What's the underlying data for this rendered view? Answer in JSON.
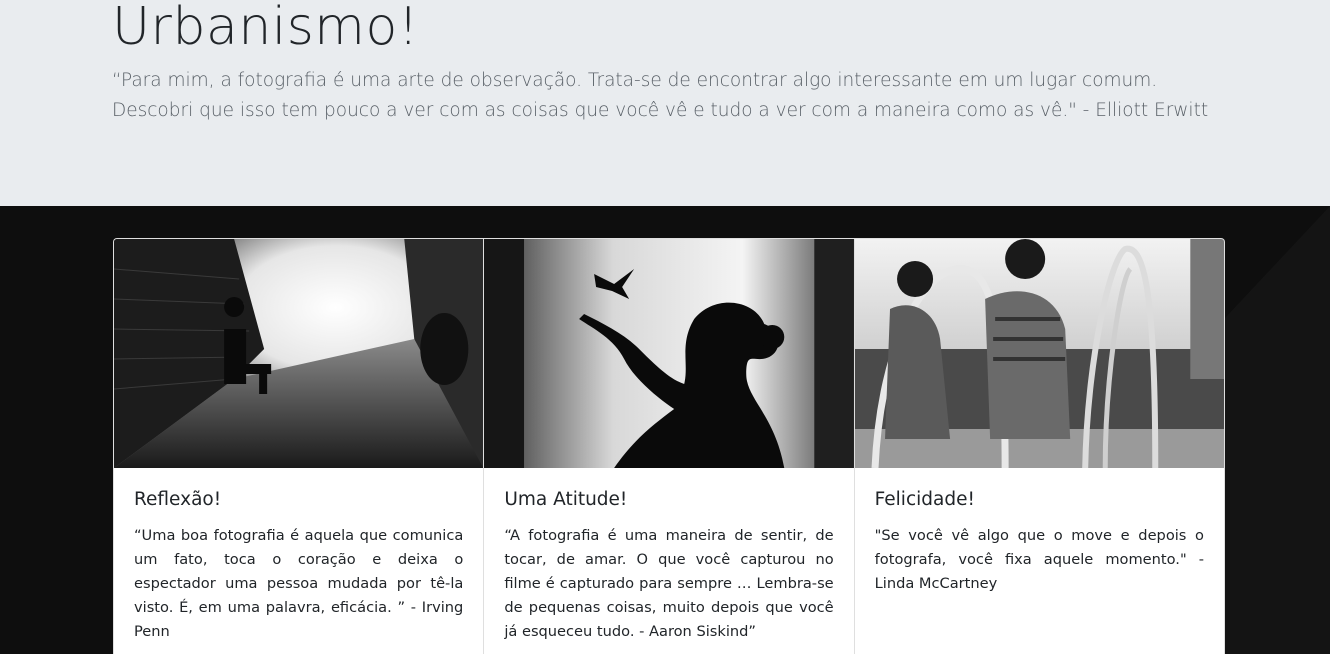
{
  "header": {
    "title": "Urbanismo!",
    "lead": "“Para mim, a fotografia é uma arte de observação. Trata-se de encontrar algo interessante em um lugar comum. Descobri que isso tem pouco a ver com as coisas que você vê e tudo a ver com a maneira como as vê.\" - Elliott Erwitt"
  },
  "cards": [
    {
      "title": "Reflexão!",
      "text": "“Uma boa fotografia é aquela que comunica um fato, toca o coração e deixa o espectador uma pessoa mudada por tê-la visto. É, em uma palavra, eficácia. ” - Irving Penn",
      "image": "alley-photo"
    },
    {
      "title": "Uma Atitude!",
      "text": "“A fotografia é uma maneira de sentir, de tocar, de amar. O que você capturou no filme é capturado para sempre … Lembra-se de pequenas coisas, muito depois que você já esqueceu tudo. - Aaron Siskind”",
      "image": "silhouette-hummingbird-photo"
    },
    {
      "title": "Felicidade!",
      "text": "\"Se você vê algo que o move e depois o fotografa, você fixa aquele momento.\" - Linda McCartney",
      "image": "children-playground-photo"
    }
  ],
  "colors": {
    "jumbotron_bg": "#e9ecef",
    "dark_section_bg": "#0e0e0e",
    "card_bg": "#ffffff",
    "text": "#212529"
  }
}
